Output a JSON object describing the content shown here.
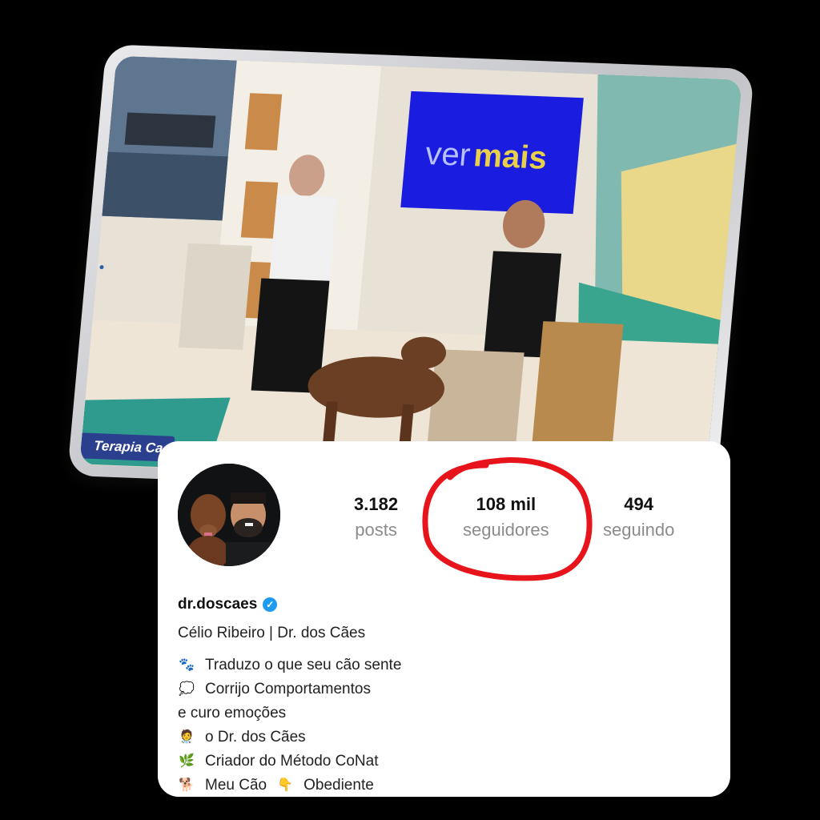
{
  "tablet": {
    "tv_screen_text": {
      "part1": "ver",
      "part2": "mais"
    },
    "caption": "Terapia Ca"
  },
  "profile": {
    "username": "dr.doscaes",
    "verified": true,
    "full_name": "Célio Ribeiro | Dr. dos Cães",
    "stats": [
      {
        "value": "3.182",
        "label": "posts"
      },
      {
        "value": "108 mil",
        "label": "seguidores"
      },
      {
        "value": "494",
        "label": "seguindo"
      }
    ],
    "highlight_color": "#e8141b",
    "bio": [
      {
        "icon": "paw-prints-icon",
        "text": "Traduzo o que seu cão sente"
      },
      {
        "icon": "speech-bubble-icon",
        "text": "Corrijo Comportamentos"
      },
      {
        "icon": "",
        "text": "e curo emoções"
      },
      {
        "icon": "doctor-icon",
        "text": "o Dr. dos Cães"
      },
      {
        "icon": "herb-icon",
        "text": "Criador do Método CoNat"
      },
      {
        "icon": "dog-icon",
        "text": "Meu Cão"
      }
    ],
    "bio_extra": {
      "icon": "pointing-down-icon",
      "text": "Obediente"
    }
  },
  "colors": {
    "verified_badge": "#1d9bf0",
    "card_bg": "#ffffff",
    "background": "#000000"
  }
}
